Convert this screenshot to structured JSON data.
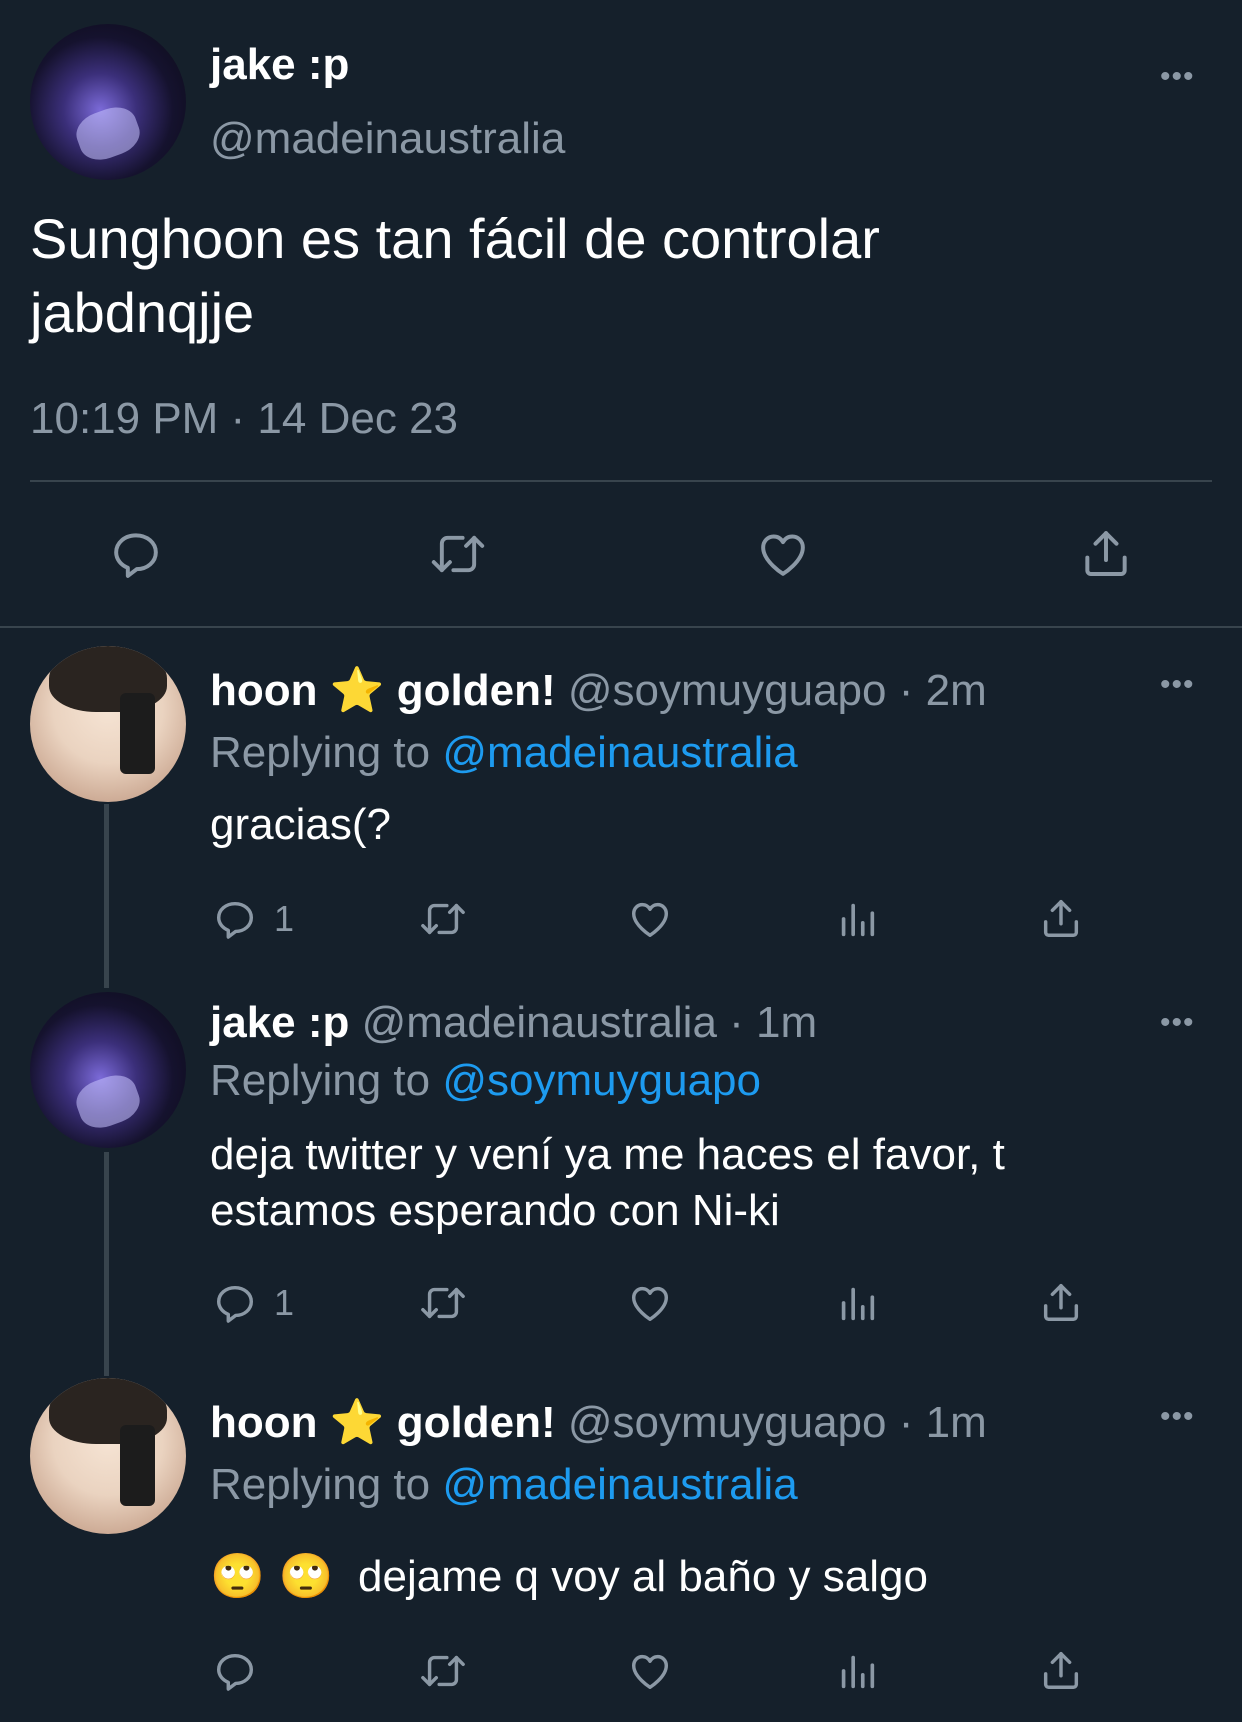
{
  "main_tweet": {
    "author_name": "jake :p",
    "author_handle": "@madeinaustralia",
    "more": "•••",
    "text_line1": "Sunghoon es tan fácil de controlar",
    "text_line2": "jabdnqjje",
    "timestamp": "10:19 PM · 14 Dec 23"
  },
  "replies": [
    {
      "author_name": "hoon",
      "star": "⭐",
      "author_name_suffix": "golden!",
      "author_handle": "@soymuyguapo",
      "time": "· 2m",
      "replying_label": "Replying to",
      "replying_to": "@madeinaustralia",
      "text_line1": "gracias(?",
      "reply_count": "1",
      "more": "•••"
    },
    {
      "author_name": "jake :p",
      "author_handle": "@madeinaustralia",
      "time": "· 1m",
      "replying_label": "Replying to",
      "replying_to": "@soymuyguapo",
      "text_line1": "deja twitter y vení ya me haces el favor, t",
      "text_line2": "estamos esperando con Ni-ki",
      "reply_count": "1",
      "more": "•••"
    },
    {
      "author_name": "hoon",
      "star": "⭐",
      "author_name_suffix": "golden!",
      "author_handle": "@soymuyguapo",
      "time": "· 1m",
      "replying_label": "Replying to",
      "replying_to": "@madeinaustralia",
      "emoji": "🙄 🙄",
      "text_line1": "dejame q voy al baño y salgo",
      "more": "•••"
    }
  ],
  "colors": {
    "background": "#15202b",
    "muted": "#8b98a5",
    "link": "#1d9bf0",
    "divider": "#38444d"
  },
  "icons": [
    "reply-icon",
    "retweet-icon",
    "like-icon",
    "views-icon",
    "share-icon",
    "more-icon"
  ]
}
